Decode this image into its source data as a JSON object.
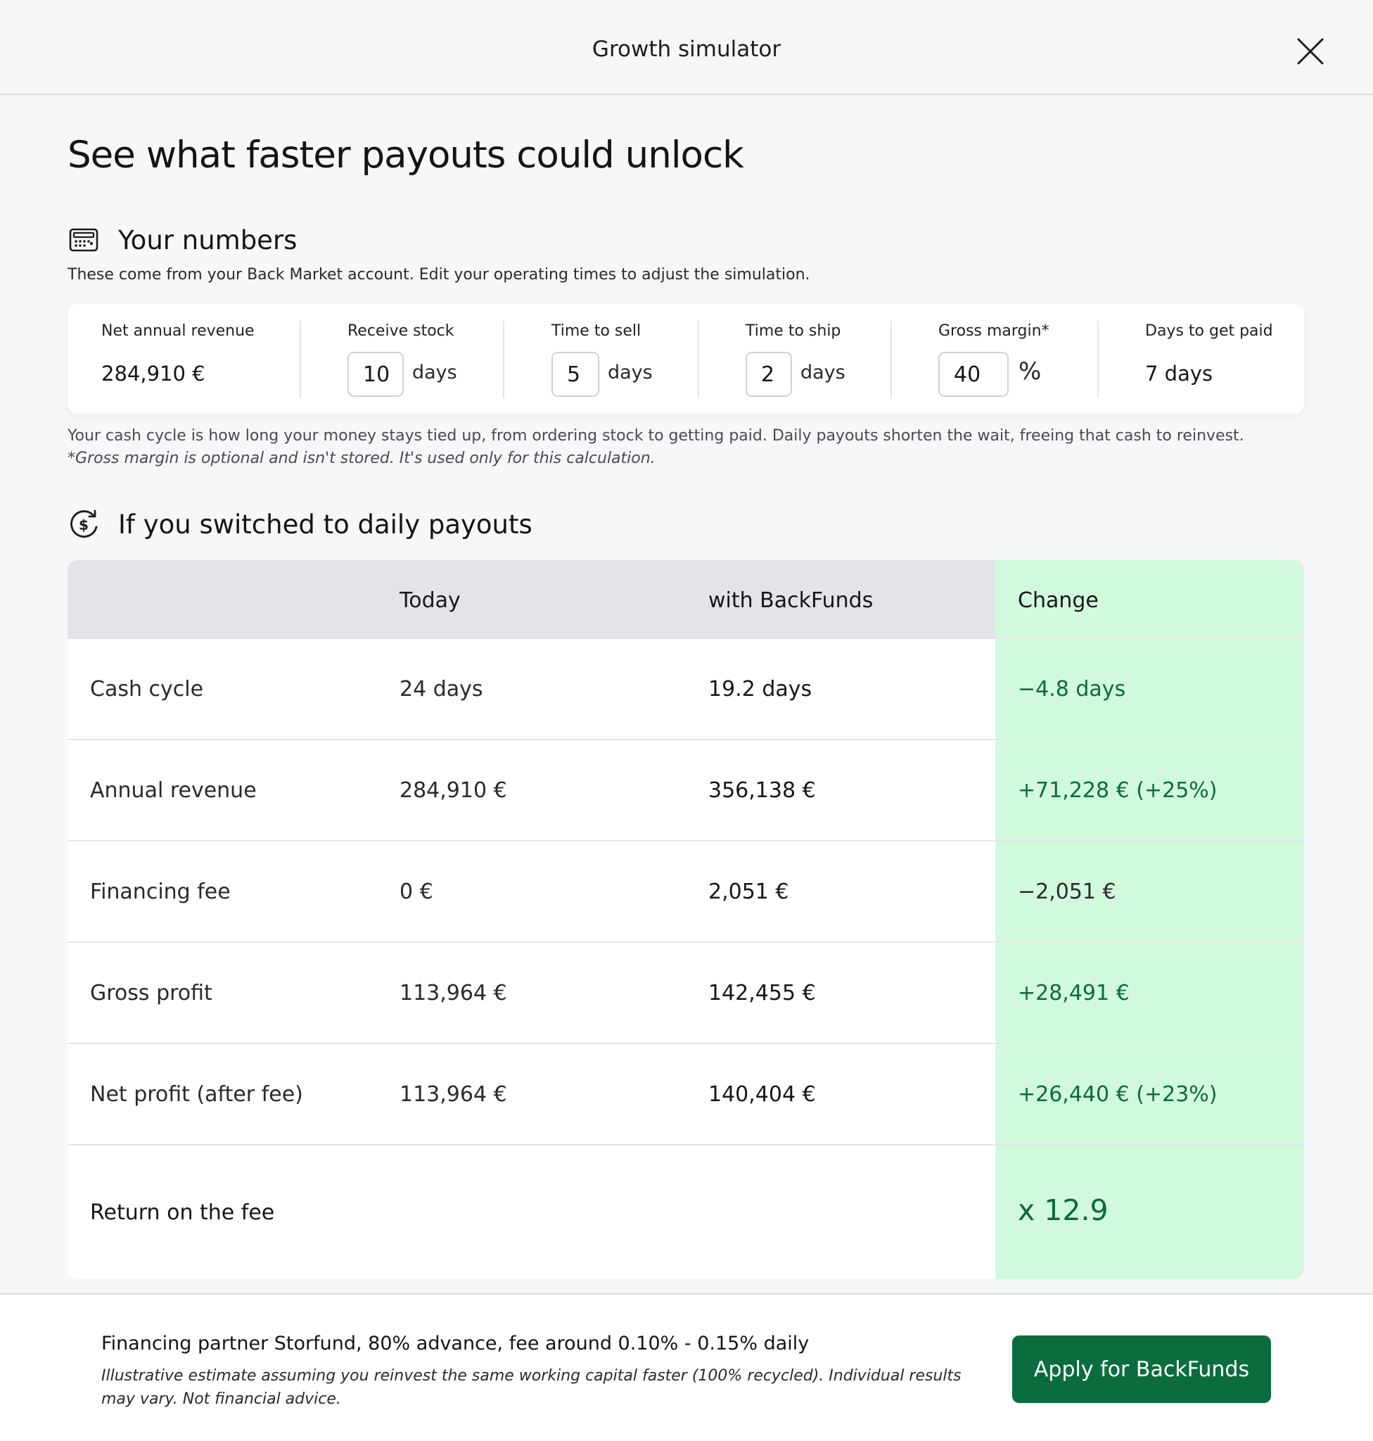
{
  "header": {
    "title": "Growth simulator"
  },
  "headline": "See what faster payouts could unlock",
  "your_numbers": {
    "title": "Your numbers",
    "description": "These come from your Back Market account. Edit your operating times to adjust the simulation.",
    "net_revenue": {
      "label": "Net annual revenue",
      "value": "284,910 €"
    },
    "receive_stock": {
      "label": "Receive stock",
      "value": "10",
      "unit": "days"
    },
    "time_to_sell": {
      "label": "Time to sell",
      "value": "5",
      "unit": "days"
    },
    "time_to_ship": {
      "label": "Time to ship",
      "value": "2",
      "unit": "days"
    },
    "gross_margin": {
      "label": "Gross margin*",
      "value": "40",
      "unit": "%"
    },
    "days_to_paid": {
      "label": "Days to get paid",
      "value": "7 days"
    },
    "note_cycle": "Your cash cycle is how long your money stays tied up, from ordering stock to getting paid. Daily payouts shorten the wait, freeing that cash to reinvest.",
    "note_margin": "*Gross margin is optional and isn't stored. It's used only for this calculation."
  },
  "daily_payouts": {
    "title": "If you switched to daily payouts",
    "columns": {
      "today": "Today",
      "backfunds": "with BackFunds",
      "change": "Change"
    },
    "rows": [
      {
        "label": "Cash cycle",
        "today": "24 days",
        "backfunds": "19.2 days",
        "change": "−4.8 days"
      },
      {
        "label": "Annual revenue",
        "today": "284,910 €",
        "backfunds": "356,138 €",
        "change": "+71,228 € (+25%)"
      },
      {
        "label": "Financing fee",
        "today": "0 €",
        "backfunds": "2,051 €",
        "change": "−2,051 €"
      },
      {
        "label": "Gross profit",
        "today": "113,964 €",
        "backfunds": "142,455 €",
        "change": "+28,491 €"
      },
      {
        "label": "Net profit (after fee)",
        "today": "113,964 €",
        "backfunds": "140,404 €",
        "change": "+26,440 € (+23%)"
      }
    ],
    "return": {
      "label": "Return on the fee",
      "value": "x 12.9"
    }
  },
  "footer": {
    "title": "Financing partner Storfund, 80% advance, fee around 0.10% - 0.15% daily",
    "disclaimer": "Illustrative estimate assuming you reinvest the same working capital faster (100% recycled). Individual results may vary. Not financial advice.",
    "apply_label": "Apply for BackFunds"
  },
  "colors": {
    "accent": "#0b6d3e",
    "change_bg": "#d1fadc",
    "positive_text": "#0c6b3a",
    "header_bg": "#e3e4e8"
  },
  "icons": [
    "close-icon",
    "calculator-icon",
    "dollar-refresh-icon"
  ]
}
